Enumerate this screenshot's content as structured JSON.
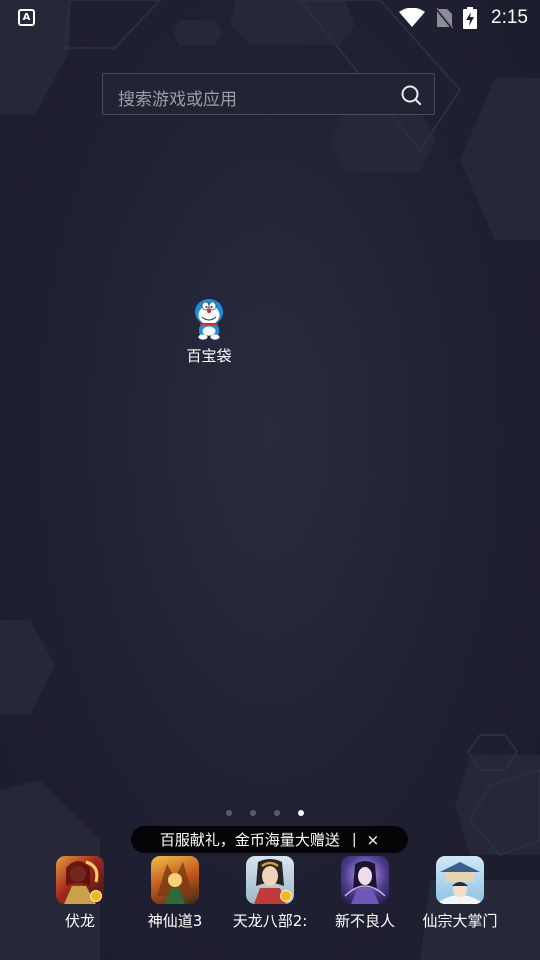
{
  "status_bar": {
    "time": "2:15",
    "app_icon_letter": "A",
    "icons": [
      "wifi-icon",
      "no-sim-icon",
      "battery-charging-icon"
    ]
  },
  "search": {
    "placeholder": "搜索游戏或应用",
    "icon": "search-icon"
  },
  "desktop_apps": [
    {
      "label": "百宝袋",
      "icon": "doraemon-icon"
    }
  ],
  "page_indicator": {
    "total": 4,
    "current": 4
  },
  "promo_banner": {
    "text": "百服献礼，金币海量大赠送",
    "divider": "|",
    "close": "×"
  },
  "dock": {
    "items": [
      {
        "label": "伏龙",
        "icon": "fulong-game-icon",
        "badge": true,
        "color": "#a3281e"
      },
      {
        "label": "神仙道3",
        "icon": "shenxiandao3-game-icon",
        "badge": false,
        "color": "#c2561c"
      },
      {
        "label": "天龙八部2:",
        "icon": "tianlongbabu2-game-icon",
        "badge": true,
        "color": "#9bb8c8"
      },
      {
        "label": "新不良人",
        "icon": "xinbuliangren-game-icon",
        "badge": false,
        "color": "#4d3d8e"
      },
      {
        "label": "仙宗大掌门",
        "icon": "xianzongdazhangmen-game-icon",
        "badge": false,
        "color": "#8fc3e2"
      }
    ]
  },
  "colors": {
    "background": "#1f2032",
    "active_dot": "#ffffff",
    "inactive_dot": "#5c5d6b",
    "banner": "#050507"
  }
}
